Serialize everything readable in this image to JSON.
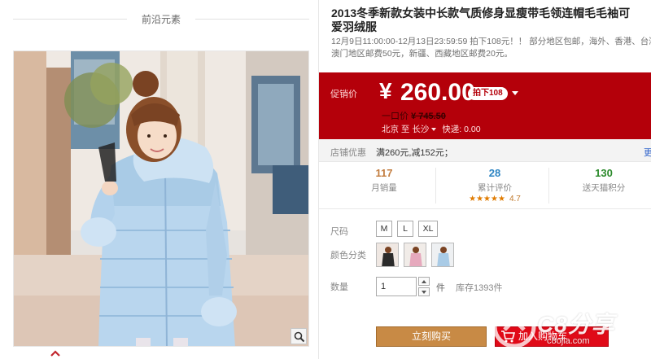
{
  "gallery": {
    "header_title": "前沿元素",
    "zoom_icon": "magnifier-icon",
    "thumb_indicator_icon": "caret-up-icon"
  },
  "product": {
    "title_line1": "2013冬季新款女装中长款气质修身显瘦带毛领连帽毛毛袖可",
    "title_line2": "爱羽绒服",
    "promo_line1": "12月9日11:00:00-12月13日23:59:59 拍下108元！！ 部分地区包邮，海外、香港、台湾、",
    "promo_line2": "澳门地区邮费50元，新疆、西藏地区邮费20元。"
  },
  "price": {
    "label": "促销价",
    "currency": "¥",
    "value": "260.00",
    "badge": "拍下108",
    "orig_label": "一口价",
    "orig_value": "¥ 745.50",
    "ship_from": "北京",
    "ship_to_word": "至",
    "ship_to": "长沙",
    "ship_method": "快递: 0.00"
  },
  "coupon": {
    "label": "店铺优惠",
    "value": "满260元,减152元；",
    "more": "更"
  },
  "stats": [
    {
      "value": "117",
      "label": "月销量"
    },
    {
      "value": "28",
      "label": "累计评价",
      "stars": "★★★★★",
      "rating": "4.7"
    },
    {
      "value": "130",
      "label": "送天猫积分"
    }
  ],
  "options": {
    "size_label": "尺码",
    "sizes": [
      "M",
      "L",
      "XL"
    ],
    "color_label": "颜色分类",
    "colors": [
      "black",
      "pink",
      "light-blue"
    ],
    "qty_label": "数量",
    "qty_value": "1",
    "qty_unit": "件",
    "stock": "库存1393件"
  },
  "actions": {
    "buy_now": "立刻购买",
    "add_to_cart": "加入购物车"
  },
  "watermark": {
    "text": "C8分享",
    "sub": "c8ojia.com"
  },
  "colors": {
    "price_bg": "#b4000a",
    "buy_button": "#c88a45",
    "cart_button": "#e00a18"
  }
}
